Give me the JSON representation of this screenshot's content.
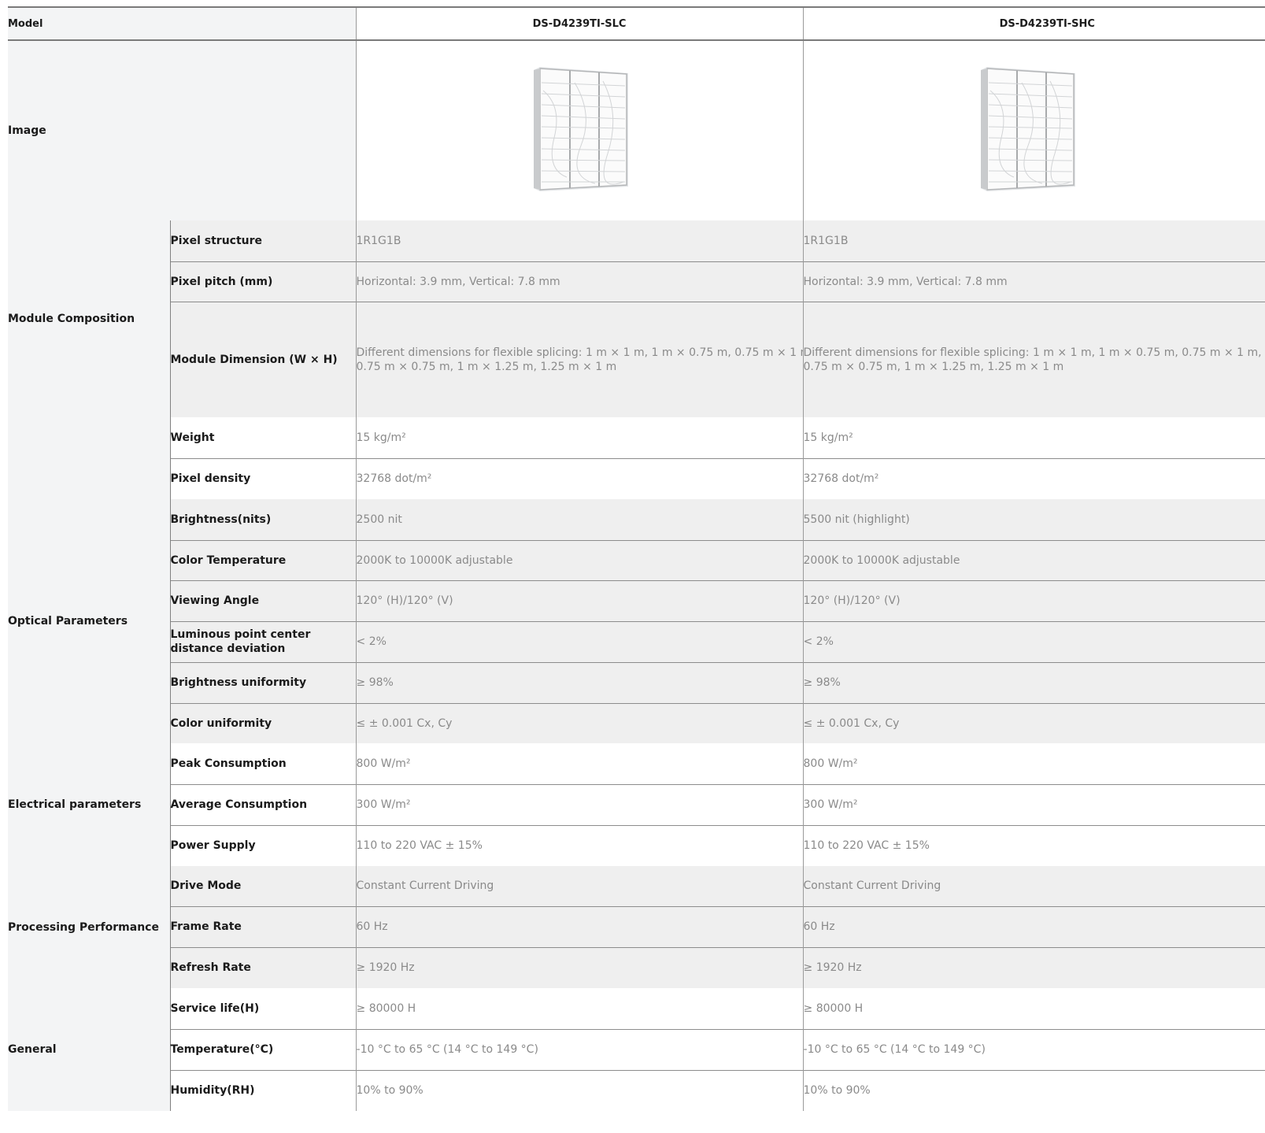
{
  "header": {
    "model_label": "Model",
    "models": [
      "DS-D4239TI-SLC",
      "DS-D4239TI-SHC"
    ]
  },
  "image_row": {
    "label": "Image",
    "icon": "led-screen-panel-icon"
  },
  "categories": {
    "module": "Module Composition",
    "optical": "Optical Parameters",
    "electrical": "Electrical parameters",
    "processing": "Processing Performance",
    "general": "General"
  },
  "rows": [
    {
      "key": "Pixel structure",
      "values": [
        "1R1G1B",
        "1R1G1B"
      ]
    },
    {
      "key": "Pixel pitch (mm)",
      "values": [
        "Horizontal: 3.9 mm, Vertical: 7.8 mm",
        "Horizontal: 3.9 mm, Vertical: 7.8 mm"
      ]
    },
    {
      "key": "Module Dimension (W × H)",
      "values": [
        "Different dimensions for flexible splicing: 1 m × 1 m, 1 m × 0.75 m, 0.75 m × 1 m,",
        "Different dimensions for flexible splicing: 1 m × 1 m, 1 m × 0.75 m, 0.75 m × 1 m,"
      ],
      "values2": [
        "0.75 m × 0.75 m, 1 m × 1.25 m, 1.25 m × 1 m",
        "0.75 m × 0.75 m, 1 m × 1.25 m, 1.25 m × 1 m"
      ]
    },
    {
      "key": "Weight",
      "values": [
        "15 kg/m²",
        "15 kg/m²"
      ]
    },
    {
      "key": "Pixel density",
      "values": [
        "32768 dot/m²",
        "32768 dot/m²"
      ]
    },
    {
      "key": "Brightness(nits)",
      "values": [
        "2500 nit",
        "5500 nit (highlight)"
      ]
    },
    {
      "key": "Color Temperature",
      "values": [
        "2000K to 10000K adjustable",
        "2000K to 10000K adjustable"
      ]
    },
    {
      "key": "Viewing Angle",
      "values": [
        "120° (H)/120° (V)",
        "120° (H)/120° (V)"
      ]
    },
    {
      "key": "Luminous point center",
      "key2": "distance deviation",
      "values": [
        "< 2%",
        "< 2%"
      ]
    },
    {
      "key": "Brightness uniformity",
      "values": [
        "≥ 98%",
        "≥ 98%"
      ]
    },
    {
      "key": "Color uniformity",
      "values": [
        "≤ ± 0.001 Cx, Cy",
        "≤ ± 0.001 Cx, Cy"
      ]
    },
    {
      "key": "Peak Consumption",
      "values": [
        "800 W/m²",
        "800 W/m²"
      ]
    },
    {
      "key": "Average Consumption",
      "values": [
        "300 W/m²",
        "300 W/m²"
      ]
    },
    {
      "key": "Power Supply",
      "values": [
        "110 to 220 VAC ± 15%",
        "110 to 220 VAC ± 15%"
      ]
    },
    {
      "key": "Drive Mode",
      "values": [
        "Constant Current Driving",
        "Constant Current Driving"
      ]
    },
    {
      "key": "Frame Rate",
      "values": [
        "60 Hz",
        "60 Hz"
      ]
    },
    {
      "key": "Refresh Rate",
      "values": [
        "≥ 1920 Hz",
        "≥ 1920 Hz"
      ]
    },
    {
      "key": "Service life(H)",
      "values": [
        "≥ 80000 H",
        "≥ 80000 H"
      ]
    },
    {
      "key": "Temperature(°C)",
      "values": [
        "-10 °C to 65 °C (14 °C to 149 °C)",
        "-10 °C to 65 °C (14 °C to 149 °C)"
      ]
    },
    {
      "key": "Humidity(RH)",
      "values": [
        "10% to 90%",
        "10% to 90%"
      ]
    }
  ]
}
